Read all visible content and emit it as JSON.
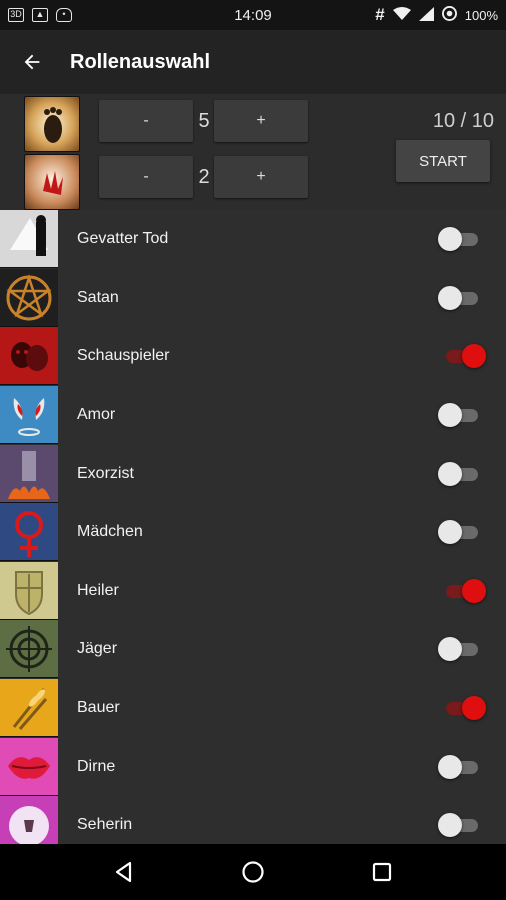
{
  "statusbar": {
    "time": "14:09",
    "battery": "100%",
    "icons_left": [
      "sim-icon",
      "image-icon",
      "cat-icon"
    ]
  },
  "appbar": {
    "title": "Rollenauswahl"
  },
  "counters": {
    "minus_label": "-",
    "plus_label": "+",
    "row1_value": "5",
    "row2_value": "2",
    "total": "10 / 10",
    "start_label": "START"
  },
  "roles": [
    {
      "label": "Gevatter Tod",
      "enabled": false,
      "icon": "death-icon",
      "color": "#d8d8d8"
    },
    {
      "label": "Satan",
      "enabled": false,
      "icon": "pentagram-icon",
      "color": "#1f1f1f"
    },
    {
      "label": "Schauspieler",
      "enabled": true,
      "icon": "masks-icon",
      "color": "#b51717"
    },
    {
      "label": "Amor",
      "enabled": false,
      "icon": "wings-icon",
      "color": "#3d8bc2"
    },
    {
      "label": "Exorzist",
      "enabled": false,
      "icon": "exorcist-icon",
      "color": "#5b4a6d"
    },
    {
      "label": "Mädchen",
      "enabled": false,
      "icon": "venus-icon",
      "color": "#2f4a82"
    },
    {
      "label": "Heiler",
      "enabled": true,
      "icon": "shield-icon",
      "color": "#cfc98f"
    },
    {
      "label": "Jäger",
      "enabled": false,
      "icon": "crosshair-icon",
      "color": "#5d6e45"
    },
    {
      "label": "Bauer",
      "enabled": true,
      "icon": "wheat-icon",
      "color": "#e8a61a"
    },
    {
      "label": "Dirne",
      "enabled": false,
      "icon": "lips-icon",
      "color": "#e04bb6"
    },
    {
      "label": "Seherin",
      "enabled": false,
      "icon": "crystal-ball-icon",
      "color": "#c73fb7"
    }
  ],
  "colors": {
    "accent": "#e00f0f",
    "background": "#2e2e2e",
    "appbar": "#232323"
  }
}
